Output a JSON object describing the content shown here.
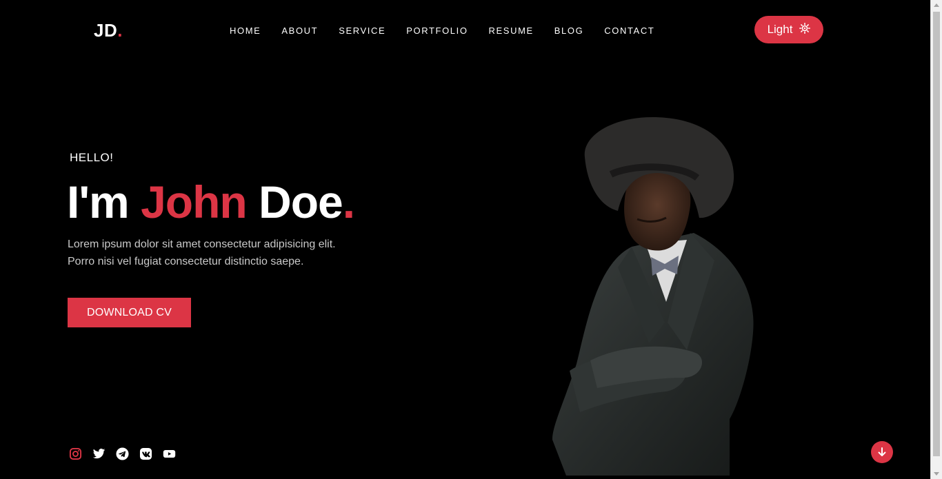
{
  "brand": {
    "logo_text": "JD",
    "logo_dot": "."
  },
  "nav": {
    "items": [
      "HOME",
      "ABOUT",
      "SERVICE",
      "PORTFOLIO",
      "RESUME",
      "BLOG",
      "CONTACT"
    ]
  },
  "theme_toggle": {
    "label": "Light",
    "icon": "sun-icon"
  },
  "hero": {
    "greeting": "HELLO!",
    "prefix": "I'm ",
    "first_name": "John",
    "last_name": " Doe",
    "dot": ".",
    "intro_line1": "Lorem ipsum dolor sit amet consectetur adipisicing elit.",
    "intro_line2": "Porro nisi vel fugiat consectetur distinctio saepe.",
    "cta_label": "DOWNLOAD CV"
  },
  "socials": [
    "instagram-icon",
    "twitter-icon",
    "telegram-icon",
    "vk-icon",
    "youtube-icon"
  ],
  "colors": {
    "accent": "#dc3545",
    "background": "#000000",
    "text": "#ffffff",
    "muted": "#c9c9c9"
  }
}
